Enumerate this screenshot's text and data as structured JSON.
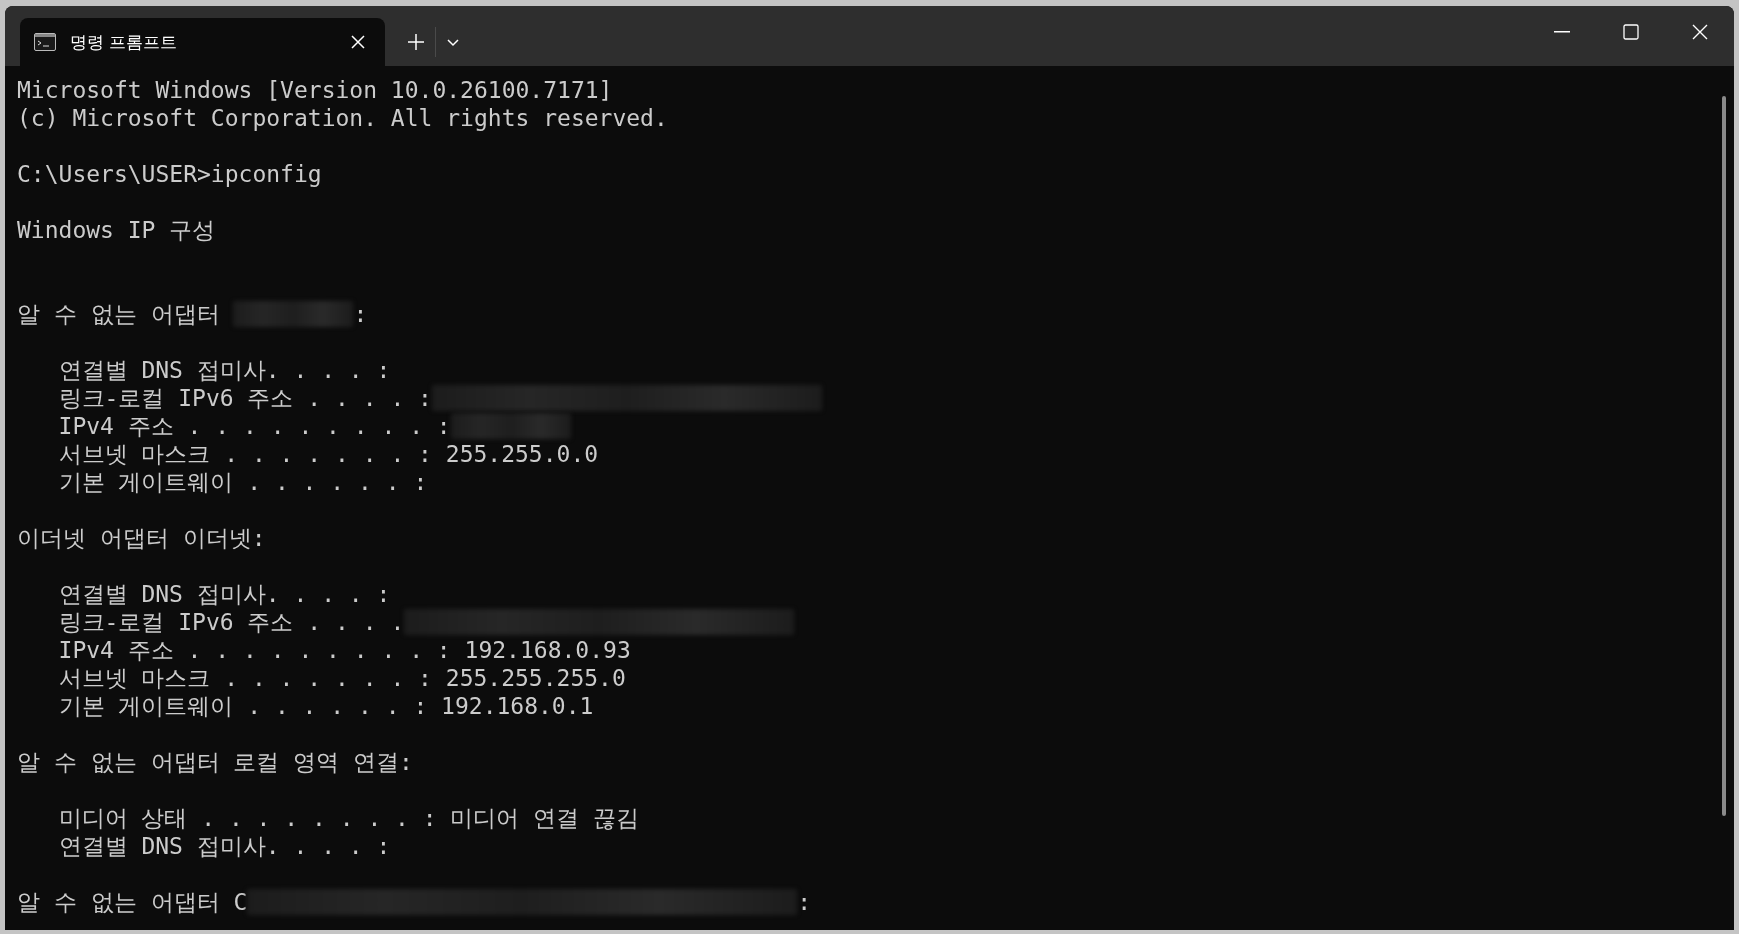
{
  "tab": {
    "title": "명령 프롬프트",
    "selected": true
  },
  "lines": [
    {
      "kind": "text",
      "text": "Microsoft Windows [Version 10.0.26100.7171]"
    },
    {
      "kind": "text",
      "text": "(c) Microsoft Corporation. All rights reserved."
    },
    {
      "kind": "blank"
    },
    {
      "kind": "text",
      "text": "C:\\Users\\USER>ipconfig"
    },
    {
      "kind": "blank"
    },
    {
      "kind": "text",
      "text": "Windows IP 구성"
    },
    {
      "kind": "blank"
    },
    {
      "kind": "blank"
    },
    {
      "kind": "text",
      "text": "알 수 없는 어댑터 ",
      "redacted": {
        "kind": "short"
      },
      "suffix": ":"
    },
    {
      "kind": "blank"
    },
    {
      "kind": "text",
      "text": "   연결별 DNS 접미사. . . . :"
    },
    {
      "kind": "text",
      "text": "   링크-로컬 IPv6 주소 . . . . :",
      "redacted": {
        "kind": "long"
      }
    },
    {
      "kind": "text",
      "text": "   IPv4 주소 . . . . . . . . . :",
      "redacted": {
        "kind": "short"
      }
    },
    {
      "kind": "text",
      "text": "   서브넷 마스크 . . . . . . . : 255.255.0.0"
    },
    {
      "kind": "text",
      "text": "   기본 게이트웨이 . . . . . . :"
    },
    {
      "kind": "blank"
    },
    {
      "kind": "text",
      "text": "이더넷 어댑터 이더넷:"
    },
    {
      "kind": "blank"
    },
    {
      "kind": "text",
      "text": "   연결별 DNS 접미사. . . . :"
    },
    {
      "kind": "text",
      "text": "   링크-로컬 IPv6 주소 . . . .",
      "redacted": {
        "kind": "long"
      }
    },
    {
      "kind": "text",
      "text": "   IPv4 주소 . . . . . . . . . : 192.168.0.93"
    },
    {
      "kind": "text",
      "text": "   서브넷 마스크 . . . . . . . : 255.255.255.0"
    },
    {
      "kind": "text",
      "text": "   기본 게이트웨이 . . . . . . : 192.168.0.1"
    },
    {
      "kind": "blank"
    },
    {
      "kind": "text",
      "text": "알 수 없는 어댑터 로컬 영역 연결:"
    },
    {
      "kind": "blank"
    },
    {
      "kind": "text",
      "text": "   미디어 상태 . . . . . . . . : 미디어 연결 끊김"
    },
    {
      "kind": "text",
      "text": "   연결별 DNS 접미사. . . . :"
    },
    {
      "kind": "blank"
    },
    {
      "kind": "text",
      "text": "알 수 없는 어댑터 C",
      "redacted": {
        "kind": "wide"
      },
      "suffix": ":"
    }
  ]
}
